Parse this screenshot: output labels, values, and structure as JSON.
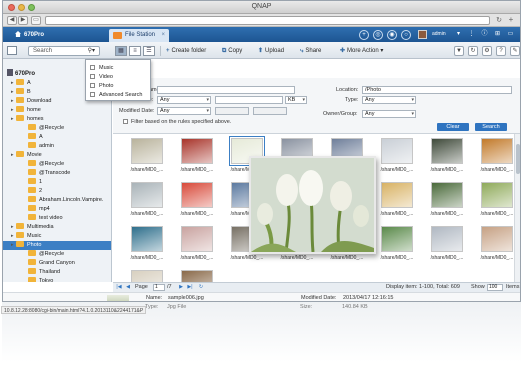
{
  "window": {
    "title": "QNAP"
  },
  "header": {
    "home_label": "670Pro",
    "active_app": "File Station",
    "user": "admin"
  },
  "toolbar": {
    "search_placeholder": "Search",
    "create_folder": "Create folder",
    "copy": "Copy",
    "upload": "Upload",
    "share": "Share",
    "more_action": "More Action"
  },
  "search_menu": {
    "items": [
      "Music",
      "Video",
      "Photo",
      "Advanced Search"
    ]
  },
  "advanced_search": {
    "name_label": "Name:",
    "location_label": "Location:",
    "location_value": "/Photo",
    "size_label": "Size:",
    "size_value": "Any",
    "size_unit": "KB",
    "type_label": "Type:",
    "type_value": "Any",
    "modified_label": "Modified Date:",
    "modified_value": "Any",
    "owner_label": "Owner/Group:",
    "owner_value": "Any",
    "filter_label": "Filter based on the rules specified above.",
    "clear_button": "Clear",
    "search_button": "Search"
  },
  "sidebar": {
    "root": "670Pro",
    "items": [
      {
        "label": "A",
        "level": 1
      },
      {
        "label": "B",
        "level": 1
      },
      {
        "label": "Download",
        "level": 1
      },
      {
        "label": "home",
        "level": 1
      },
      {
        "label": "homes",
        "level": 1
      },
      {
        "label": "@Recycle",
        "level": 2
      },
      {
        "label": "A",
        "level": 2
      },
      {
        "label": "admin",
        "level": 2
      },
      {
        "label": "Movie",
        "level": 1
      },
      {
        "label": "@Recycle",
        "level": 2
      },
      {
        "label": "@Transcode",
        "level": 2
      },
      {
        "label": "1",
        "level": 2
      },
      {
        "label": "2",
        "level": 2
      },
      {
        "label": "Abraham.Lincoln.Vampire.",
        "level": 2
      },
      {
        "label": "mp4",
        "level": 2
      },
      {
        "label": "test video",
        "level": 2
      },
      {
        "label": "Multimedia",
        "level": 1
      },
      {
        "label": "Music",
        "level": 1
      },
      {
        "label": "Photo",
        "level": 1
      },
      {
        "label": "@Recycle",
        "level": 2
      },
      {
        "label": "Grand Canyon",
        "level": 2
      },
      {
        "label": "Thailand",
        "level": 2
      },
      {
        "label": "Tokyo",
        "level": 2
      }
    ]
  },
  "grid": {
    "thumbs": [
      {
        "caption": "/share/MD0_...",
        "color": "#b9b39c"
      },
      {
        "caption": "/share/MD0_...",
        "color": "#a8342a"
      },
      {
        "caption": "/share/MD0_...",
        "color": "#e6ead8"
      },
      {
        "caption": "/share/MD0_...",
        "color": "#8a92a0"
      },
      {
        "caption": "/share/MD0_...",
        "color": "#6f7f9a"
      },
      {
        "caption": "/share/MD0_...",
        "color": "#c9cfd6"
      },
      {
        "caption": "/share/MD0_...",
        "color": "#3f4a3a"
      },
      {
        "caption": "/share/MD0_...",
        "color": "#c27a2a"
      },
      {
        "caption": "/share/MD0_...",
        "color": "#a9b3b8"
      },
      {
        "caption": "/share/MD0_...",
        "color": "#d84a3a"
      },
      {
        "caption": "/share/MD0_...",
        "color": "#5c7aa0"
      },
      {
        "caption": "/share/MD0_...",
        "color": "#99a7ab"
      },
      {
        "caption": "/share/MD0_...",
        "color": "#7a5238"
      },
      {
        "caption": "/share/MD0_...",
        "color": "#d8b264"
      },
      {
        "caption": "/share/MD0_...",
        "color": "#4a6a3a"
      },
      {
        "caption": "/share/MD0_...",
        "color": "#8faa5a"
      },
      {
        "caption": "/share/MD0_...",
        "color": "#2e6f8c"
      },
      {
        "caption": "/share/MD0_...",
        "color": "#c9a3a0"
      },
      {
        "caption": "/share/MD0_...",
        "color": "#777064"
      },
      {
        "caption": "/share/MD0_...",
        "color": "#5c3a2a"
      },
      {
        "caption": "/share/MD0_...",
        "color": "#cf5a3a"
      },
      {
        "caption": "/share/MD0_...",
        "color": "#5a8a4a"
      },
      {
        "caption": "/share/MD0_...",
        "color": "#b0b8c2"
      },
      {
        "caption": "/share/MD0_...",
        "color": "#c6a184"
      },
      {
        "caption": "/share/MD0_...",
        "color": "#d8d0c0"
      },
      {
        "caption": "/share/MD0_...",
        "color": "#8a6a4a"
      }
    ]
  },
  "statusbar": {
    "page_label": "Page",
    "page_value": "1",
    "page_total": "/7",
    "display_text": "Display item: 1-100, Total: 609",
    "show_label": "Show",
    "show_value": "100",
    "show_unit": "Items"
  },
  "info": {
    "name_label": "Name:",
    "name_value": "sample006.jpg",
    "type_label": "Type:",
    "type_value": "Jpg File",
    "modified_label": "Modified Date:",
    "modified_value": "2013/04/17 12:16:15",
    "size_label": "Size:",
    "size_value": "140.84 KB"
  },
  "status_url": "10.8.12.28:8080/cgi-bin/main.html?4.1.0.2013110&2244171&P"
}
